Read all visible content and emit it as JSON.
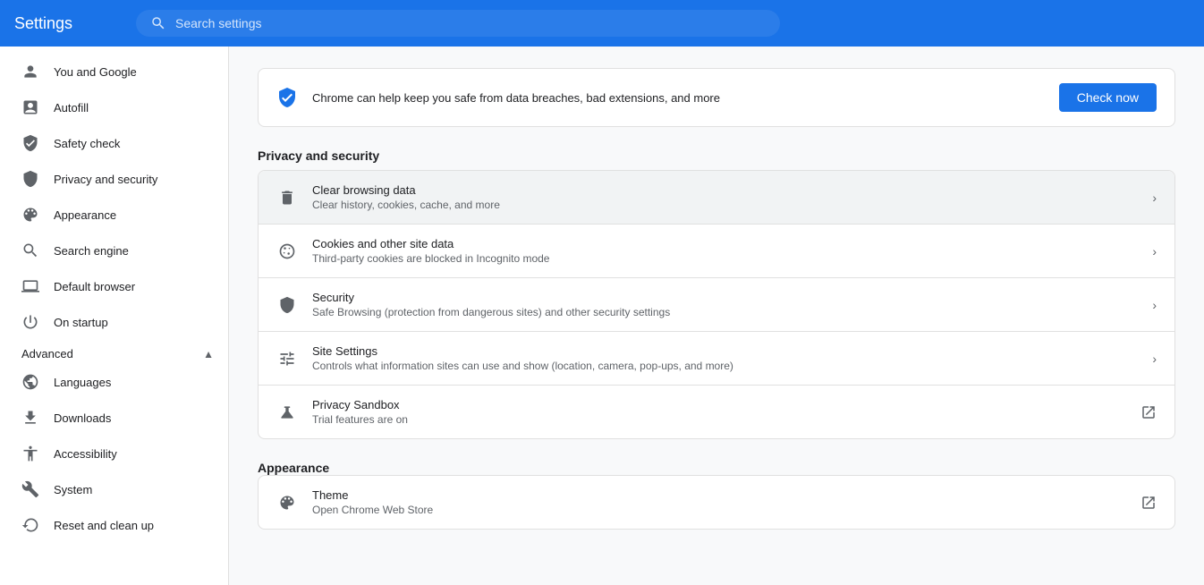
{
  "header": {
    "title": "Settings",
    "search_placeholder": "Search settings"
  },
  "sidebar": {
    "items": [
      {
        "id": "you-and-google",
        "label": "You and Google",
        "icon": "person"
      },
      {
        "id": "autofill",
        "label": "Autofill",
        "icon": "autofill"
      },
      {
        "id": "safety-check",
        "label": "Safety check",
        "icon": "shield"
      },
      {
        "id": "privacy-security",
        "label": "Privacy and security",
        "icon": "shield-lock"
      },
      {
        "id": "appearance",
        "label": "Appearance",
        "icon": "palette"
      },
      {
        "id": "search-engine",
        "label": "Search engine",
        "icon": "search"
      },
      {
        "id": "default-browser",
        "label": "Default browser",
        "icon": "monitor"
      },
      {
        "id": "on-startup",
        "label": "On startup",
        "icon": "power"
      }
    ],
    "advanced": {
      "label": "Advanced",
      "items": [
        {
          "id": "languages",
          "label": "Languages",
          "icon": "globe"
        },
        {
          "id": "downloads",
          "label": "Downloads",
          "icon": "download"
        },
        {
          "id": "accessibility",
          "label": "Accessibility",
          "icon": "accessibility"
        },
        {
          "id": "system",
          "label": "System",
          "icon": "settings"
        },
        {
          "id": "reset-clean",
          "label": "Reset and clean up",
          "icon": "history"
        }
      ]
    }
  },
  "safety_banner": {
    "text": "Chrome can help keep you safe from data breaches, bad extensions, and more",
    "button_label": "Check now"
  },
  "privacy_section": {
    "title": "Privacy and security",
    "rows": [
      {
        "id": "clear-browsing",
        "title": "Clear browsing data",
        "subtitle": "Clear history, cookies, cache, and more",
        "icon": "trash",
        "action": "arrow",
        "highlighted": true
      },
      {
        "id": "cookies",
        "title": "Cookies and other site data",
        "subtitle": "Third-party cookies are blocked in Incognito mode",
        "icon": "cookie",
        "action": "arrow",
        "highlighted": false
      },
      {
        "id": "security",
        "title": "Security",
        "subtitle": "Safe Browsing (protection from dangerous sites) and other security settings",
        "icon": "shield",
        "action": "arrow",
        "highlighted": false
      },
      {
        "id": "site-settings",
        "title": "Site Settings",
        "subtitle": "Controls what information sites can use and show (location, camera, pop-ups, and more)",
        "icon": "sliders",
        "action": "arrow",
        "highlighted": false
      },
      {
        "id": "privacy-sandbox",
        "title": "Privacy Sandbox",
        "subtitle": "Trial features are on",
        "icon": "experiment",
        "action": "external",
        "highlighted": false
      }
    ]
  },
  "appearance_section": {
    "title": "Appearance",
    "rows": [
      {
        "id": "theme",
        "title": "Theme",
        "subtitle": "Open Chrome Web Store",
        "icon": "palette",
        "action": "external",
        "highlighted": false
      }
    ]
  }
}
